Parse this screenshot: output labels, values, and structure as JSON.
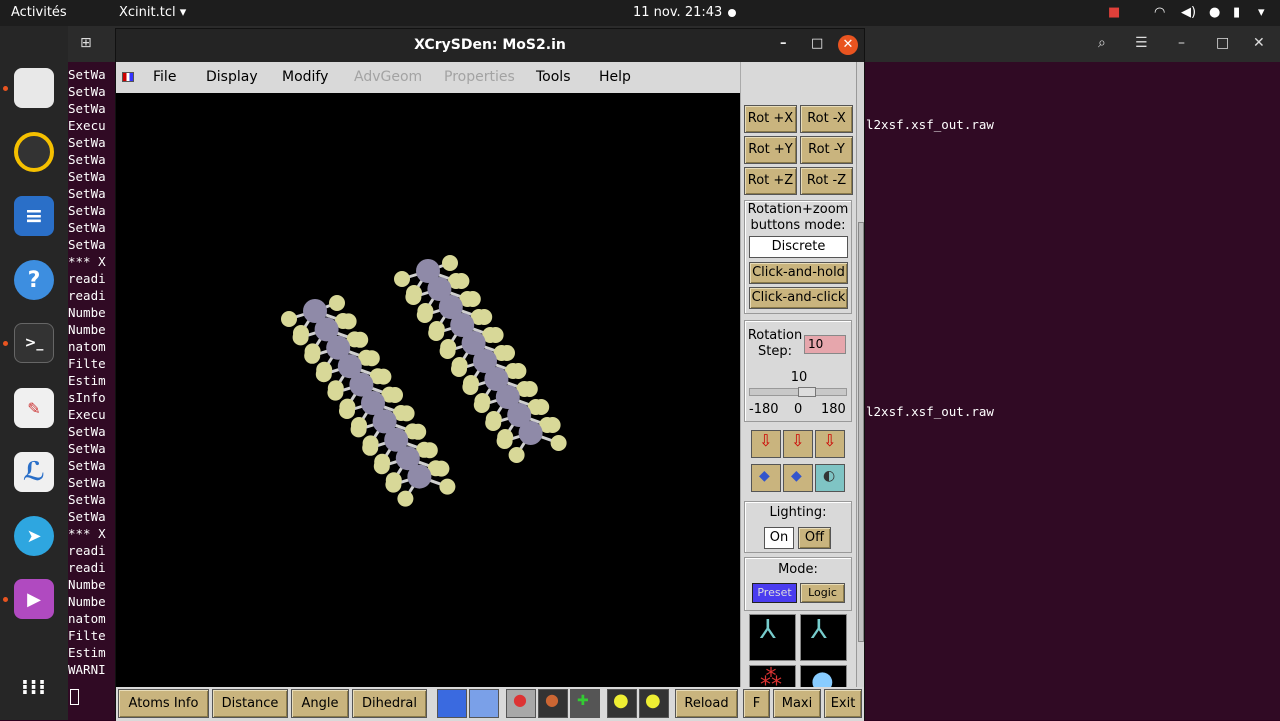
{
  "topbar": {
    "activities": "Activités",
    "app_menu": "Xcinit.tcl ▾",
    "clock": "11 nov.  21:43"
  },
  "terminal": {
    "lines": [
      "SetWa",
      "SetWa",
      "SetWa",
      "Execu",
      "SetWa",
      "SetWa",
      "SetWa",
      "SetWa",
      "SetWa",
      "SetWa",
      "SetWa",
      "*** X",
      "readi",
      "readi",
      "Numbe",
      "Numbe",
      "natom",
      "Filte",
      "Estim",
      "sInfo",
      "Execu",
      "SetWa",
      "SetWa",
      "SetWa",
      "SetWa",
      "SetWa",
      "SetWa",
      "*** X",
      "readi",
      "readi",
      "Numbe",
      "Numbe",
      "natom",
      "Filte",
      "Estim",
      "WARNI"
    ],
    "right_line_1": "l2xsf.xsf_out.raw",
    "right_line_2": "l2xsf.xsf_out.raw"
  },
  "xwindow": {
    "title": "XCrySDen: MoS2.in",
    "menu": {
      "file": "File",
      "display": "Display",
      "modify": "Modify",
      "advgeom": "AdvGeom",
      "properties": "Properties",
      "tools": "Tools",
      "help": "Help"
    },
    "panel": {
      "rot_px": "Rot +X",
      "rot_mx": "Rot -X",
      "rot_py": "Rot +Y",
      "rot_my": "Rot -Y",
      "rot_pz": "Rot +Z",
      "rot_mz": "Rot -Z",
      "mode_label": "Rotation+zoom buttons mode:",
      "discrete": "Discrete",
      "click_hold": "Click-and-hold",
      "click_click": "Click-and-click",
      "rot_step_label": "Rotation Step:",
      "rot_step_value": "10",
      "slider_value": "10",
      "slider_min": "-180",
      "slider_mid": "0",
      "slider_max": "180",
      "lighting_label": "Lighting:",
      "lighting_on": "On",
      "lighting_off": "Off",
      "mode2_label": "Mode:",
      "preset": "Preset",
      "logic": "Logic"
    },
    "bottom": {
      "atoms_info": "Atoms Info",
      "distance": "Distance",
      "angle": "Angle",
      "dihedral": "Dihedral",
      "reload": "Reload",
      "f": "F",
      "maxi": "Maxi",
      "exit": "Exit"
    }
  },
  "colors": {
    "mo_atom": "#8f8aa8",
    "s_atom": "#d8d898",
    "bond": "#cfcfcf",
    "tk_button": "#c9b47e",
    "preset_active": "#4a3cf0"
  }
}
